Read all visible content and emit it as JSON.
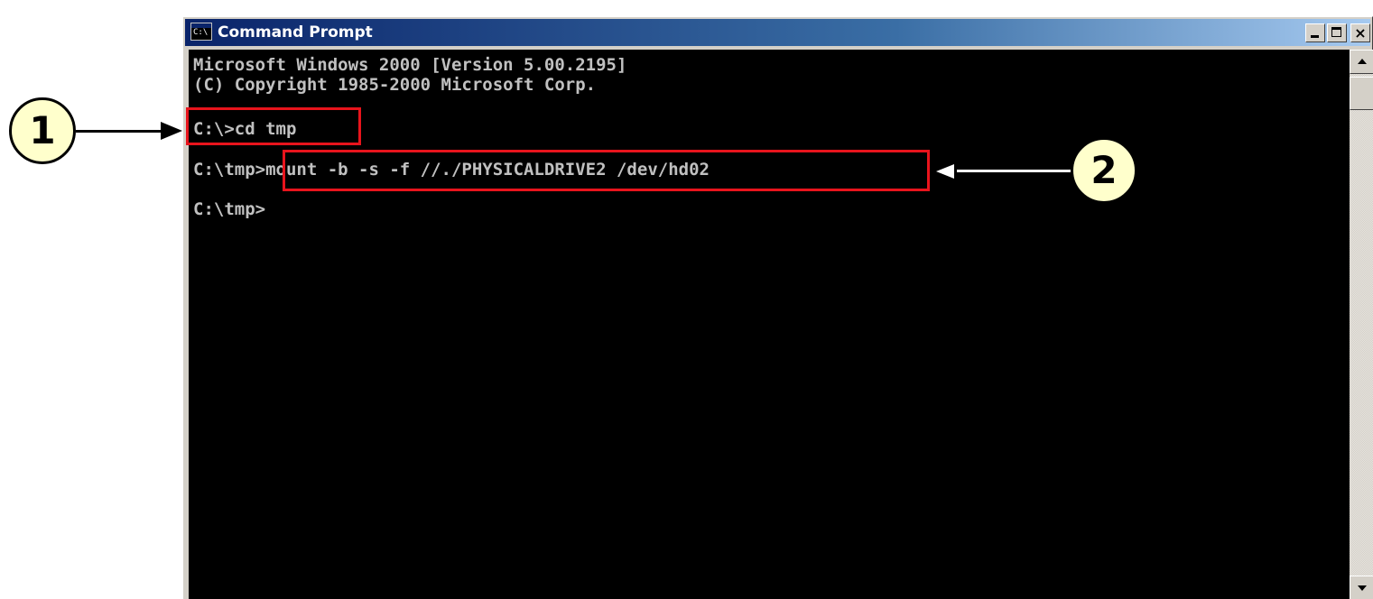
{
  "window": {
    "title": "Command Prompt",
    "icon": "console-icon",
    "icon_glyph": "C:\\",
    "buttons": {
      "minimize": "minimize-icon",
      "maximize": "maximize-icon",
      "close": "close-icon",
      "close_glyph": "×"
    }
  },
  "console": {
    "lines": [
      "Microsoft Windows 2000 [Version 5.00.2195]",
      "(C) Copyright 1985-2000 Microsoft Corp.",
      "",
      "C:\\>cd tmp",
      "",
      "C:\\tmp>mount -b -s -f //./PHYSICALDRIVE2 /dev/hd02",
      "",
      "C:\\tmp>"
    ]
  },
  "annotations": {
    "callout_1": "1",
    "callout_2": "2",
    "highlight_color": "#e8141c",
    "callout_fill": "#ffffcc"
  },
  "colors": {
    "titlebar_start": "#0a246a",
    "titlebar_end": "#a6caf0",
    "console_bg": "#000000",
    "console_text": "#c0c0c0"
  }
}
